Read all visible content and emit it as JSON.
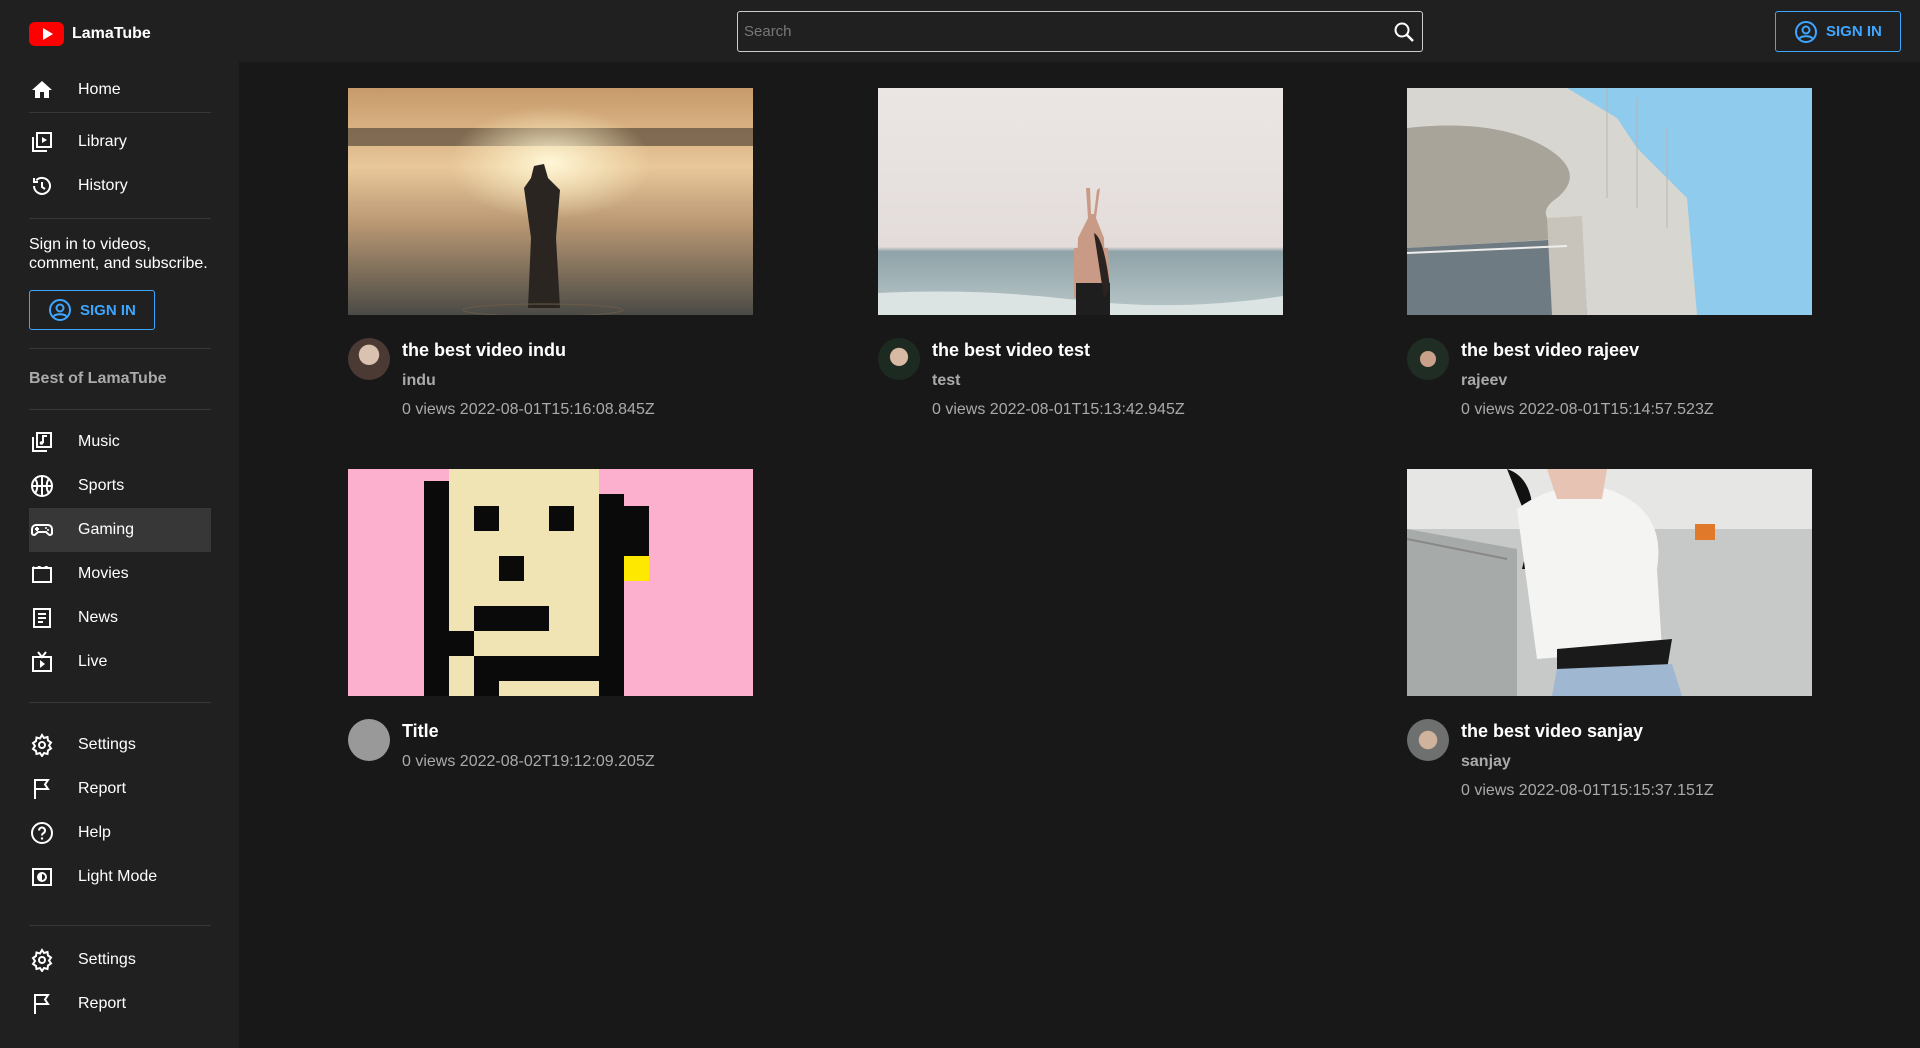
{
  "app": {
    "name": "LamaTube"
  },
  "sidebar": {
    "items_top": [
      {
        "label": "Home",
        "icon": "home-icon"
      },
      {
        "label": "Library",
        "icon": "library-icon"
      },
      {
        "label": "History",
        "icon": "history-icon"
      }
    ],
    "signin_text": "Sign in to videos, comment, and subscribe.",
    "signin_button": "SIGN IN",
    "section_title": "Best of LamaTube",
    "items_mid": [
      {
        "label": "Music",
        "icon": "music-icon"
      },
      {
        "label": "Sports",
        "icon": "sports-icon"
      },
      {
        "label": "Gaming",
        "icon": "gaming-icon"
      },
      {
        "label": "Movies",
        "icon": "movies-icon"
      },
      {
        "label": "News",
        "icon": "news-icon"
      },
      {
        "label": "Live",
        "icon": "live-icon"
      }
    ],
    "items_low": [
      {
        "label": "Settings",
        "icon": "settings-icon"
      },
      {
        "label": "Report",
        "icon": "report-icon"
      },
      {
        "label": "Help",
        "icon": "help-icon"
      },
      {
        "label": "Light Mode",
        "icon": "light-mode-icon"
      }
    ],
    "items_bottom": [
      {
        "label": "Settings",
        "icon": "settings-icon"
      },
      {
        "label": "Report",
        "icon": "report-icon"
      }
    ],
    "active_item": "Gaming"
  },
  "header": {
    "search_placeholder": "Search",
    "signin_button": "SIGN IN"
  },
  "videos": [
    {
      "title": "the best video indu",
      "channel": "indu",
      "info": "0 views 2022-08-01T15:16:08.845Z"
    },
    {
      "title": "the best video test",
      "channel": "test",
      "info": "0 views 2022-08-01T15:13:42.945Z"
    },
    {
      "title": "the best video rajeev",
      "channel": "rajeev",
      "info": "0 views 2022-08-01T15:14:57.523Z"
    },
    {
      "title": "Title",
      "channel": "",
      "info": "0 views 2022-08-02T19:12:09.205Z"
    },
    {
      "title": "the best video sanjay",
      "channel": "sanjay",
      "info": "0 views 2022-08-01T15:15:37.151Z"
    }
  ],
  "colors": {
    "accent": "#3ea6ff",
    "brand": "#ff0000",
    "background": "#181818",
    "panel": "#202020"
  }
}
